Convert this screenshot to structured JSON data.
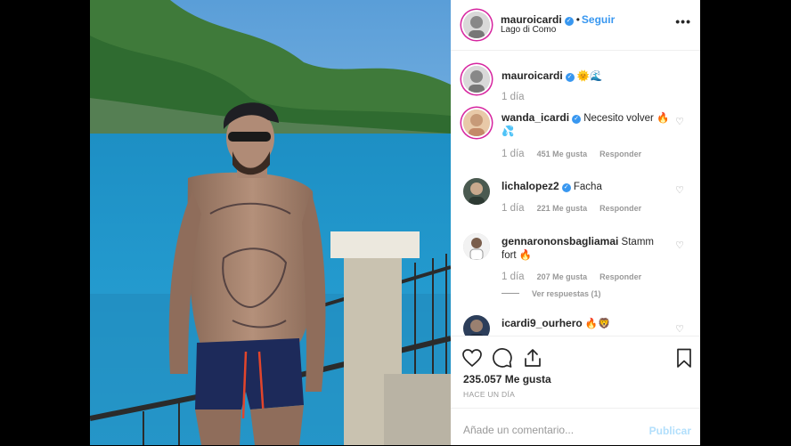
{
  "post": {
    "username": "mauroicardi",
    "follow_label": "Seguir",
    "dot": "•",
    "location": "Lago di Como",
    "more": "•••"
  },
  "comments": [
    {
      "username": "mauroicardi",
      "text": " 🌞🌊",
      "time": "1 día",
      "likes": "",
      "reply": ""
    },
    {
      "username": "wanda_icardi",
      "text": " Necesito volver 🔥💦",
      "time": "1 día",
      "likes": "451 Me gusta",
      "reply": "Responder"
    },
    {
      "username": "lichalopez2",
      "text": " Facha",
      "time": "1 día",
      "likes": "221 Me gusta",
      "reply": "Responder"
    },
    {
      "username": "gennarononsbagliamai",
      "text": " Stamm fort 🔥",
      "time": "1 día",
      "likes": "207 Me gusta",
      "reply": "Responder",
      "view_replies": "Ver respuestas (1)"
    },
    {
      "username": "icardi9_ourhero",
      "text": " 🔥🦁",
      "time": "",
      "likes": "",
      "reply": ""
    }
  ],
  "actions": {
    "like_icon": "heart-icon",
    "comment_icon": "comment-icon",
    "share_icon": "share-icon",
    "save_icon": "bookmark-icon",
    "likes_count": "235.057 Me gusta",
    "ago": "HACE UN DÍA"
  },
  "add_comment": {
    "placeholder": "Añade un comentario...",
    "publish": "Publicar"
  },
  "colors": {
    "accent": "#3897f0",
    "publish_disabled": "#b2dffc"
  }
}
